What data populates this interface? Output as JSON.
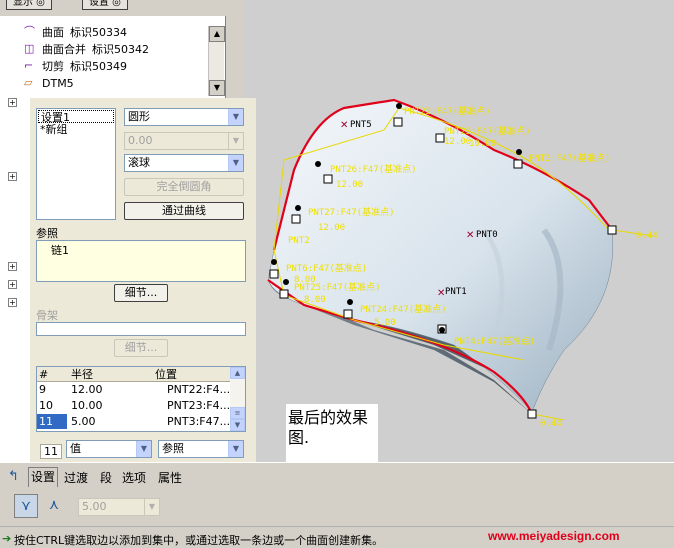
{
  "tree": {
    "top_buttons": [
      "显示 ◎",
      "设置 ◎"
    ],
    "items": [
      {
        "icon": "surface-icon",
        "label": "曲面",
        "id_label": "标识50334"
      },
      {
        "icon": "merge-icon",
        "label": "曲面合并",
        "id_label": "标识50342"
      },
      {
        "icon": "trim-icon",
        "label": "切剪",
        "id_label": "标识50349"
      },
      {
        "icon": "datum-plane-icon",
        "label": "DTM5",
        "id_label": ""
      }
    ]
  },
  "dialog": {
    "sets": [
      "设置1",
      "*新组"
    ],
    "shape_select": "圆形",
    "value_field": "0.00",
    "method_select": "滚球",
    "full_round_button": "完全倒圆角",
    "through_curve_button": "通过曲线",
    "references_label": "参照",
    "references": [
      "链1"
    ],
    "details_button": "细节...",
    "skeleton_label": "骨架",
    "skeleton_details_button": "细节...",
    "table": {
      "headers": [
        "#",
        "半径",
        "位置"
      ],
      "rows": [
        {
          "num": "9",
          "radius": "12.00",
          "location": "PNT22:F4..."
        },
        {
          "num": "10",
          "radius": "10.00",
          "location": "PNT23:F4..."
        },
        {
          "num": "11",
          "radius": "5.00",
          "location": "PNT3:F47..."
        }
      ],
      "selected_row": 2
    },
    "bottom_num": "11",
    "value_select": "值",
    "reference_select": "参照"
  },
  "tabs": [
    "设置",
    "过渡",
    "段",
    "选项",
    "属性"
  ],
  "options": {
    "radius_field": "5.00"
  },
  "status": {
    "message": "按住CTRL键选取边以添加到集中，或通过选取一条边或一个曲面创建新集。",
    "watermark": "www.meiyadesign.com"
  },
  "note": "最后的效果图.",
  "viewport": {
    "labels": {
      "pnt22": "PNT22:F47(基准点)",
      "pnt23": "PNT23:F47(基准点)",
      "pnt3": "PNT3:F47(基准点)",
      "pnt26": "PNT26:F47(基准点)",
      "pnt27": "PNT27:F47(基准点)",
      "pnt6": "PNT6:F47(基准点)",
      "pnt25": "PNT25:F47(基准点)",
      "pnt24": "PNT24:F47(基准点)",
      "pnt4": "PNT4:F47(基准点)",
      "pnt0": "PNT0",
      "pnt1": "PNT1",
      "pnt2": "PNT2",
      "pnt5": "PNT5",
      "pnt8": "PNT8",
      "val_12a": "12.00",
      "val_10": "10.00",
      "val_12b": "12.00",
      "val_12c": "12.00",
      "val_044": "0.44",
      "val_8a": "8.00",
      "val_8b": "8.00",
      "val_5": "5.00",
      "val_044b": "0.44"
    },
    "colors": {
      "edge_red": "#e0001a",
      "callout_yellow": "#f0e000",
      "surface_light": "#dfe8f0",
      "surface_shade": "#9fb2c2"
    }
  }
}
